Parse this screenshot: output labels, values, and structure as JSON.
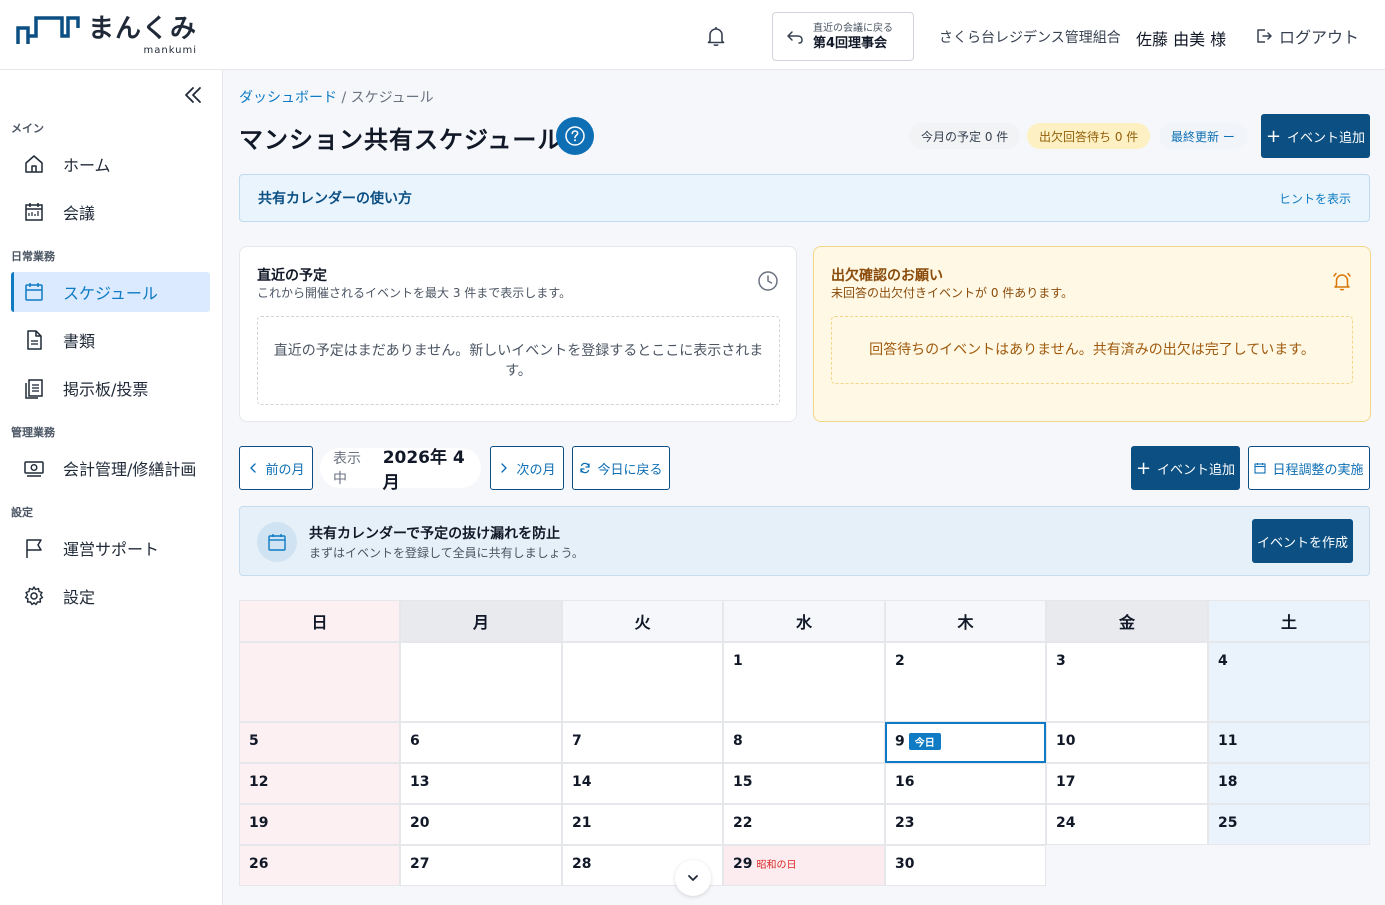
{
  "header": {
    "logo_title": "まんくみ",
    "logo_sub": "mankumi",
    "meeting_small": "直近の会議に戻る",
    "meeting_name": "第4回理事会",
    "org_name": "さくら台レジデンス管理組合",
    "user_name": "佐藤 由美 様",
    "logout_label": "ログアウト"
  },
  "sidebar": {
    "sections": {
      "main": "メイン",
      "daily": "日常業務",
      "admin": "管理業務",
      "settings": "設定"
    },
    "items": {
      "home": "ホーム",
      "meeting": "会議",
      "schedule": "スケジュール",
      "documents": "書類",
      "board": "掲示板/投票",
      "accounting": "会計管理/修繕計画",
      "support": "運営サポート",
      "settings": "設定"
    }
  },
  "breadcrumb": {
    "home": "ダッシュボード",
    "separator": "/",
    "current": "スケジュール"
  },
  "page": {
    "title": "マンション共有スケジュール",
    "pill_month": "今月の予定 0 件",
    "pill_pending": "出欠回答待ち 0 件",
    "pill_updated": "最終更新 ー",
    "add_event": "イベント追加"
  },
  "hint": {
    "title": "共有カレンダーの使い方",
    "link": "ヒントを表示"
  },
  "upcoming": {
    "title": "直近の予定",
    "sub": "これから開催されるイベントを最大 3 件まで表示します。",
    "empty": "直近の予定はまだありません。新しいイベントを登録するとここに表示されます。"
  },
  "attendance": {
    "title": "出欠確認のお願い",
    "sub": "未回答の出欠付きイベントが 0 件あります。",
    "empty": "回答待ちのイベントはありません。共有済みの出欠は完了しています。"
  },
  "month_nav": {
    "prev": "前の月",
    "label": "表示中",
    "value": "2026年 4月",
    "next": "次の月",
    "today": "今日に戻る",
    "add_event": "イベント追加",
    "schedule_adjust": "日程調整の実施"
  },
  "promo": {
    "title": "共有カレンダーで予定の抜け漏れを防止",
    "sub": "まずはイベントを登録して全員に共有しましょう。",
    "button": "イベントを作成"
  },
  "calendar": {
    "weekdays": [
      "日",
      "月",
      "火",
      "水",
      "木",
      "金",
      "土"
    ],
    "today_label": "今日",
    "holiday_label": "昭和の日",
    "weeks": [
      [
        "",
        "",
        "",
        "1",
        "2",
        "3",
        "4"
      ],
      [
        "5",
        "6",
        "7",
        "8",
        "9",
        "10",
        "11"
      ],
      [
        "12",
        "13",
        "14",
        "15",
        "16",
        "17",
        "18"
      ],
      [
        "19",
        "20",
        "21",
        "22",
        "23",
        "24",
        "25"
      ],
      [
        "26",
        "27",
        "28",
        "29",
        "30",
        "",
        ""
      ]
    ]
  },
  "colors": {
    "primary": "#0b4f83",
    "accent": "#0e7bc4",
    "warning_bg": "#fef8e4",
    "holiday_text": "#dc2626"
  }
}
